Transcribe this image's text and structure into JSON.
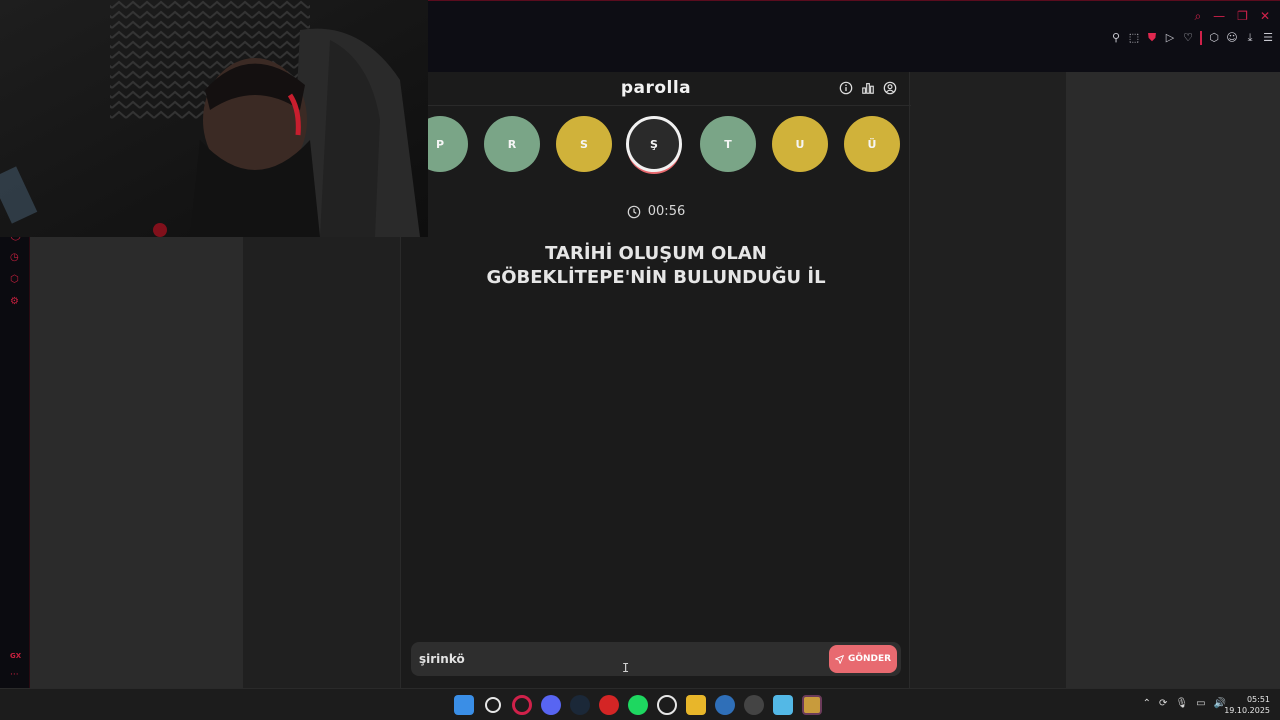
{
  "game": {
    "logo": "parolla",
    "header_icons": [
      "info-icon",
      "stats-icon",
      "user-icon"
    ],
    "letters": [
      {
        "letter": "P",
        "state": "green"
      },
      {
        "letter": "R",
        "state": "green"
      },
      {
        "letter": "S",
        "state": "yellow"
      },
      {
        "letter": "Ş",
        "state": "current"
      },
      {
        "letter": "T",
        "state": "green"
      },
      {
        "letter": "U",
        "state": "yellow"
      },
      {
        "letter": "Ü",
        "state": "yellow"
      }
    ],
    "timer": "00:56",
    "question_line1": "TARİHİ OLUŞUM OLAN",
    "question_line2": "GÖBEKLİTEPE'NİN BULUNDUĞU İL",
    "answer_value": "şirinkö",
    "send_label": "GÖNDER"
  },
  "colors": {
    "green": "#7aa587",
    "yellow": "#d0b23a",
    "accent": "#e86a70",
    "opera_red": "#d0214a"
  },
  "sidebar": {
    "gx_label": "GX",
    "more_label": "···"
  },
  "taskbar": {
    "time": "05:51",
    "date": "19.10.2025",
    "apps": [
      "windows-start",
      "search",
      "opera-gx",
      "discord",
      "steam",
      "app-red",
      "spotify",
      "logitech",
      "file-explorer",
      "app-cube",
      "app-clock",
      "notepad",
      "league-of-legends"
    ]
  }
}
